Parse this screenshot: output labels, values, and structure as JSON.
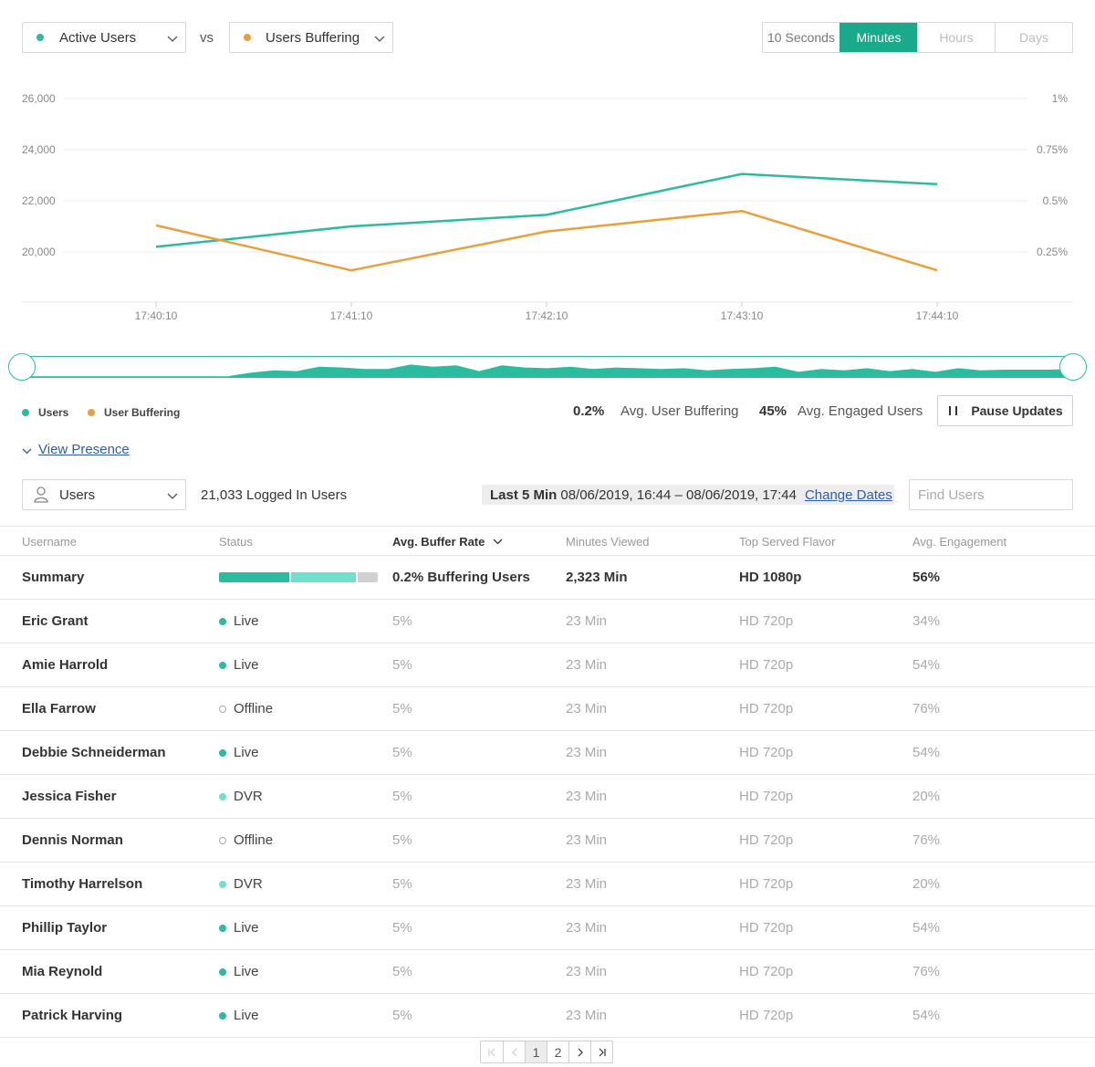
{
  "metric_select_1": {
    "label": "Active Users",
    "color": "#2bbca0"
  },
  "vs_label": "vs",
  "metric_select_2": {
    "label": "Users Buffering",
    "color": "#e8a03a"
  },
  "time_options": [
    "10 Seconds",
    "Minutes",
    "Hours",
    "Days"
  ],
  "time_selected": "Minutes",
  "chart_data": {
    "type": "line",
    "x": [
      "17:40:10",
      "17:41:10",
      "17:42:10",
      "17:43:10",
      "17:44:10"
    ],
    "y_left_ticks": [
      "26,000",
      "24,000",
      "22,000",
      "20,000"
    ],
    "y_right_ticks": [
      "1%",
      "0.75%",
      "0.5%",
      "0.25%"
    ],
    "ylim_left": [
      18000,
      26000
    ],
    "ylim_right": [
      0,
      1
    ],
    "grid": true,
    "series": [
      {
        "name": "Users",
        "axis": "left",
        "color": "#2bbca0",
        "values": [
          20200,
          21000,
          21450,
          23050,
          22650
        ]
      },
      {
        "name": "User Buffering",
        "axis": "right",
        "color": "#e8a03a",
        "values": [
          0.38,
          0.16,
          0.35,
          0.45,
          0.16
        ]
      }
    ]
  },
  "overview": {
    "color": "#2bbca0",
    "values": [
      0.05,
      0.05,
      0.05,
      0.05,
      0.05,
      0.05,
      0.05,
      0.05,
      0.05,
      0.05,
      0.3,
      0.45,
      0.4,
      0.7,
      0.65,
      0.55,
      0.55,
      0.85,
      0.7,
      0.8,
      0.4,
      0.8,
      0.65,
      0.6,
      0.7,
      0.55,
      0.65,
      0.6,
      0.55,
      0.6,
      0.45,
      0.55,
      0.6,
      0.7,
      0.35,
      0.55,
      0.45,
      0.6,
      0.4,
      0.55,
      0.35,
      0.6,
      0.45,
      0.5,
      0.5,
      0.5,
      0.55
    ]
  },
  "legend": [
    {
      "label": "Users",
      "color": "#2bbca0"
    },
    {
      "label": "User Buffering",
      "color": "#e8a03a"
    }
  ],
  "stats": {
    "buffering_value": "0.2%",
    "buffering_label": "Avg. User Buffering",
    "engaged_value": "45%",
    "engaged_label": "Avg. Engaged Users"
  },
  "pause_label": "Pause Updates",
  "view_presence_label": "View Presence",
  "users_select_label": "Users",
  "logged_in_text": "21,033 Logged In Users",
  "date_range": {
    "prefix": "Last 5 Min",
    "text": "08/06/2019, 16:44 – 08/06/2019, 17:44",
    "change_label": "Change Dates"
  },
  "search_placeholder": "Find Users",
  "table": {
    "headers": [
      "Username",
      "Status",
      "Avg. Buffer Rate",
      "Minutes Viewed",
      "Top Served Flavor",
      "Avg. Engagement"
    ],
    "summary": {
      "name": "Summary",
      "bar": [
        0.45,
        0.42,
        0.13
      ],
      "bar_colors": [
        "#2bbca0",
        "#6fe0cb",
        "#d0d0d0"
      ],
      "buffer": "0.2% Buffering Users",
      "minutes": "2,323 Min",
      "flavor": "HD 1080p",
      "engagement": "56%"
    },
    "status_colors": {
      "Live": "#2bbca0",
      "DVR": "#6fe0cb",
      "Offline": "#ffffff"
    },
    "rows": [
      {
        "name": "Eric Grant",
        "status": "Live",
        "buffer": "5%",
        "minutes": "23 Min",
        "flavor": "HD 720p",
        "engagement": "34%"
      },
      {
        "name": "Amie Harrold",
        "status": "Live",
        "buffer": "5%",
        "minutes": "23 Min",
        "flavor": "HD 720p",
        "engagement": "54%"
      },
      {
        "name": "Ella Farrow",
        "status": "Offline",
        "buffer": "5%",
        "minutes": "23 Min",
        "flavor": "HD 720p",
        "engagement": "76%"
      },
      {
        "name": "Debbie Schneiderman",
        "status": "Live",
        "buffer": "5%",
        "minutes": "23 Min",
        "flavor": "HD 720p",
        "engagement": "54%"
      },
      {
        "name": "Jessica Fisher",
        "status": "DVR",
        "buffer": "5%",
        "minutes": "23 Min",
        "flavor": "HD 720p",
        "engagement": "20%"
      },
      {
        "name": "Dennis Norman",
        "status": "Offline",
        "buffer": "5%",
        "minutes": "23 Min",
        "flavor": "HD 720p",
        "engagement": "76%"
      },
      {
        "name": "Timothy Harrelson",
        "status": "DVR",
        "buffer": "5%",
        "minutes": "23 Min",
        "flavor": "HD 720p",
        "engagement": "20%"
      },
      {
        "name": "Phillip Taylor",
        "status": "Live",
        "buffer": "5%",
        "minutes": "23 Min",
        "flavor": "HD 720p",
        "engagement": "54%"
      },
      {
        "name": "Mia Reynold",
        "status": "Live",
        "buffer": "5%",
        "minutes": "23 Min",
        "flavor": "HD 720p",
        "engagement": "76%"
      },
      {
        "name": "Patrick Harving",
        "status": "Live",
        "buffer": "5%",
        "minutes": "23 Min",
        "flavor": "HD 720p",
        "engagement": "54%"
      }
    ]
  },
  "pagination": {
    "pages": [
      "1",
      "2"
    ],
    "current": "1"
  }
}
